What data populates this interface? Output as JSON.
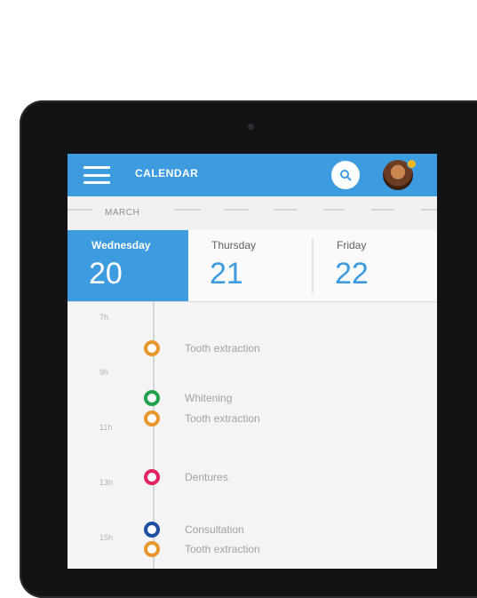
{
  "app": {
    "title": "CALENDAR"
  },
  "calendar": {
    "month": "MARCH",
    "days": [
      {
        "name": "Wednesday",
        "number": "20",
        "selected": true
      },
      {
        "name": "Thursday",
        "number": "21",
        "selected": false
      },
      {
        "name": "Friday",
        "number": "22",
        "selected": false
      }
    ]
  },
  "timeline": {
    "times": [
      "7h",
      "9h",
      "11h",
      "13h",
      "15h"
    ],
    "events": [
      {
        "label": "Tooth extraction",
        "color": "#e8962e"
      },
      {
        "label": "Whitening",
        "color": "#23a24d"
      },
      {
        "label": "Tooth extraction",
        "color": "#e8962e"
      },
      {
        "label": "Dentures",
        "color": "#e0245e"
      },
      {
        "label": "Consultation",
        "color": "#1f4fa3"
      },
      {
        "label": "Tooth extraction",
        "color": "#e8962e"
      }
    ]
  },
  "colors": {
    "primary": "#3d9be0",
    "avatar_badge": "#f5b81e"
  }
}
